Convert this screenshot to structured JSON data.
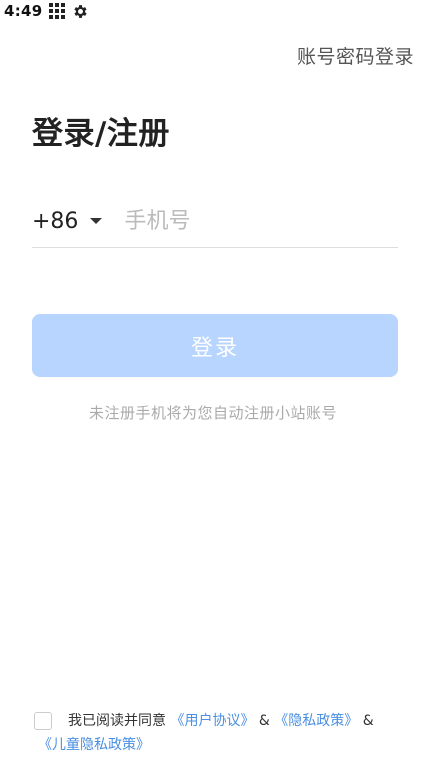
{
  "status_bar": {
    "time": "4:49",
    "icons": [
      "grid-icon",
      "gear-icon"
    ]
  },
  "header": {
    "account_login": "账号密码登录"
  },
  "main": {
    "title": "登录/注册",
    "country_code": "+86",
    "phone_placeholder": "手机号",
    "login_button": "登录",
    "hint": "未注册手机将为您自动注册小站账号"
  },
  "agreement": {
    "prefix": "我已阅读并同意",
    "user_agreement": "《用户协议》",
    "amp1": "&",
    "privacy_policy": "《隐私政策》",
    "amp2": "&",
    "child_privacy_policy": "《儿童隐私政策》"
  },
  "colors": {
    "accent_link": "#4a8fe2",
    "button_disabled": "#b7d5ff"
  }
}
